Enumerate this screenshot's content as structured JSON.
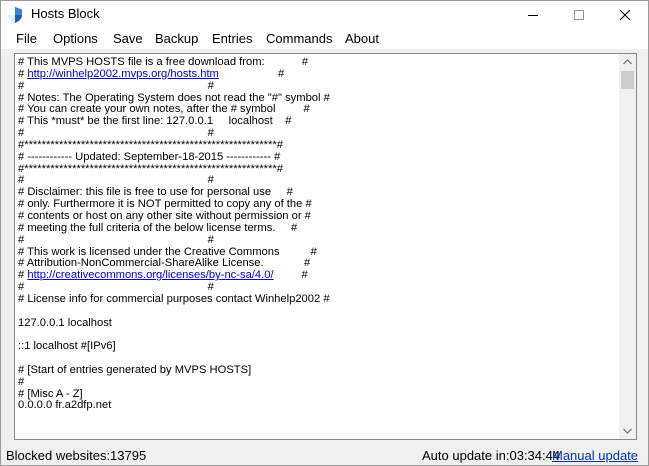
{
  "window": {
    "title": "Hosts Block",
    "app_icon": "shield-icon",
    "controls": [
      "minimize-icon",
      "maximize-icon",
      "close-icon"
    ]
  },
  "menu": [
    "File",
    "Options",
    "Save",
    "Backup",
    "Entries",
    "Commands",
    "About"
  ],
  "editor": {
    "lines": [
      "# This MVPS HOSTS file is a free download from:            #",
      {
        "text": "# ",
        "link": "http://winhelp2002.mvps.org/hosts.htm",
        "after": "                   #"
      },
      "#                                                           #",
      "# Notes: The Operating System does not read the \"#\" symbol #",
      "# You can create your own notes, after the # symbol         #",
      "# This *must* be the first line: 127.0.0.1     localhost    #",
      "#                                                           #",
      "#**********************************************************#",
      "# ------------ Updated: September-18-2015 ------------ #",
      "#**********************************************************#",
      "#                                                           #",
      "# Disclaimer: this file is free to use for personal use     #",
      "# only. Furthermore it is NOT permitted to copy any of the #",
      "# contents or host on any other site without permission or #",
      "# meeting the full criteria of the below license terms.     #",
      "#                                                           #",
      "# This work is licensed under the Creative Commons          #",
      "# Attribution-NonCommercial-ShareAlike License.             #",
      {
        "text": "# ",
        "link": "http://creativecommons.org/licenses/by-nc-sa/4.0/",
        "after": "         #"
      },
      "#                                                           #",
      "# License info for commercial purposes contact Winhelp2002 #",
      "",
      "127.0.0.1 localhost",
      "",
      "::1 localhost #[IPv6]",
      "",
      "# [Start of entries generated by MVPS HOSTS]",
      "#",
      "# [Misc A - Z]",
      "0.0.0.0 fr.a2dfp.net"
    ]
  },
  "status": {
    "blocked_label": "Blocked websites:13795",
    "auto_update": "Auto update in:03:34:44",
    "manual_update": "Manual update"
  },
  "colors": {
    "link": "#0000cc",
    "status_link": "#0033aa",
    "background": "#f0f0f0"
  }
}
